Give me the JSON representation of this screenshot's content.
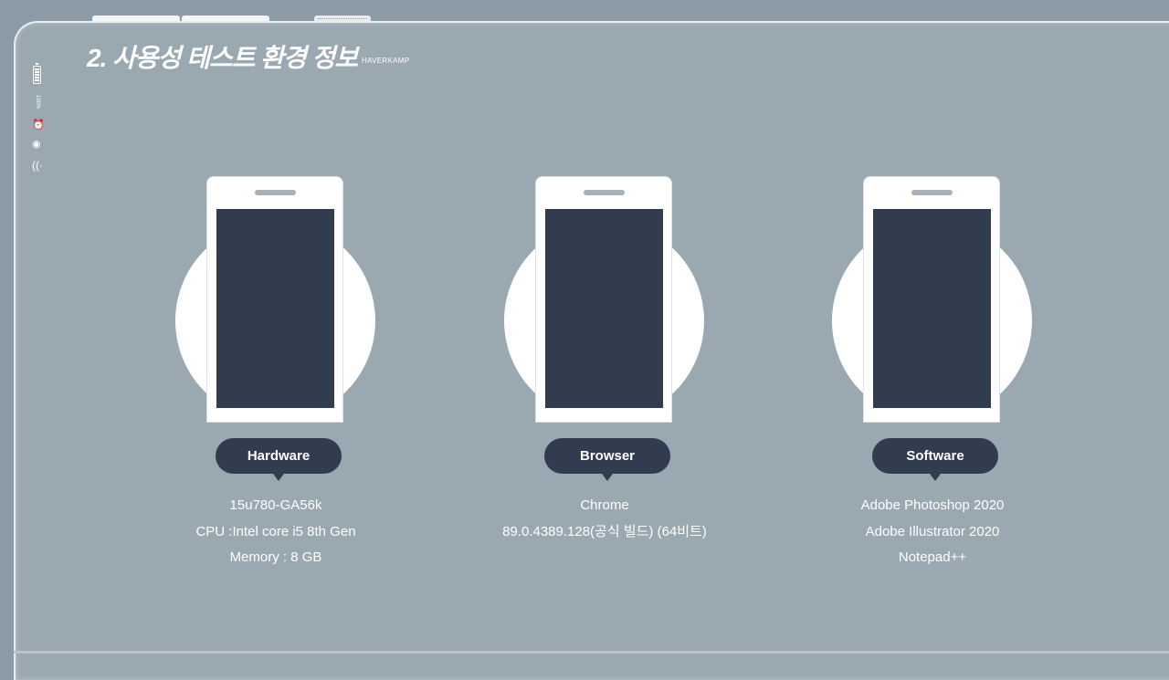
{
  "title": "2. 사용성 테스트 환경 정보",
  "title_tag": "HAVERKAMP",
  "status": {
    "battery_percent": "100%",
    "icons": [
      "battery-icon",
      "alarm-icon",
      "target-icon",
      "wifi-icon"
    ]
  },
  "colors": {
    "background": "#9aa8b1",
    "dark": "#323c4f",
    "light": "#ffffff"
  },
  "cards": [
    {
      "label": "Hardware",
      "lines": [
        "15u780-GA56k",
        "CPU :Intel core i5 8th Gen",
        "Memory :  8 GB"
      ]
    },
    {
      "label": "Browser",
      "lines": [
        "Chrome",
        "89.0.4389.128(공식 빌드) (64비트)",
        ""
      ]
    },
    {
      "label": "Software",
      "lines": [
        "Adobe Photoshop 2020",
        "Adobe Illustrator 2020",
        "Notepad++"
      ]
    }
  ]
}
